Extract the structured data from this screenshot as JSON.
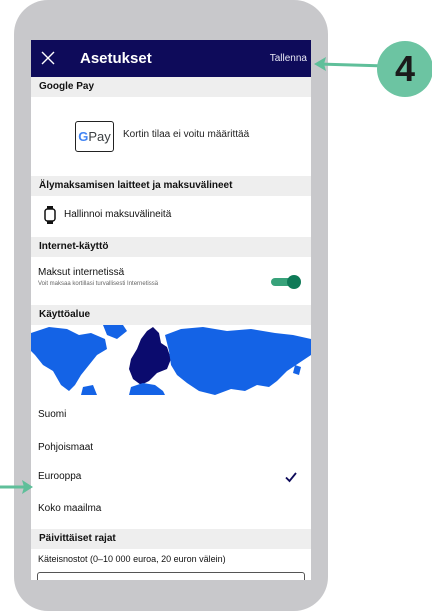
{
  "appbar": {
    "title": "Asetukset",
    "save_label": "Tallenna",
    "close_icon": "close-icon"
  },
  "google_pay": {
    "header": "Google Pay",
    "logo_g": "G",
    "logo_pay": "Pay",
    "status_text": "Kortin tilaa ei voitu määrittää"
  },
  "smart_payment": {
    "header": "Älymaksamisen laitteet ja maksuvälineet",
    "manage_label": "Hallinnoi maksuvälineitä",
    "icon": "watch-icon"
  },
  "internet": {
    "header": "Internet-käyttö",
    "toggle_label": "Maksut internetissä",
    "toggle_subtext": "Voit maksaa kortillasi turvallisesti Internetissä",
    "toggle_on": true
  },
  "region": {
    "header": "Käyttöalue",
    "options": [
      "Suomi",
      "Pohjoismaat",
      "Eurooppa",
      "Koko maailma"
    ],
    "selected": "Eurooppa"
  },
  "limits": {
    "header": "Päivittäiset rajat",
    "cash_label": "Käteisnostot (0–10 000 euroa, 20 euron välein)"
  },
  "annotation": {
    "step_number": "4"
  },
  "colors": {
    "appbar": "#0e0b5a",
    "accent_green": "#0f7a57",
    "map_world": "#1463e6",
    "map_europe": "#0b0b6e",
    "badge": "#6cc4a2"
  }
}
